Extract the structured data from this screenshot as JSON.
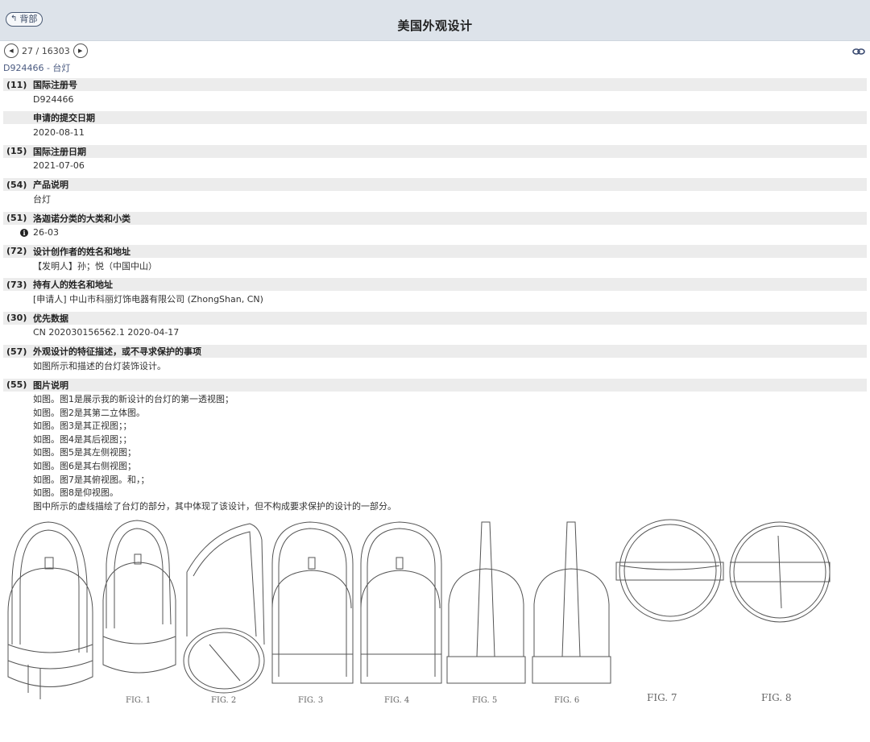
{
  "header": {
    "back_label": "背部",
    "title": "美国外观设计"
  },
  "pager": {
    "position": "27 / 16303"
  },
  "record": {
    "id_title": "D924466 - 台灯"
  },
  "fields": [
    {
      "code": "(11)",
      "label": "国际注册号",
      "value": "D924466"
    },
    {
      "code": "",
      "label": "申请的提交日期",
      "value": "2020-08-11"
    },
    {
      "code": "(15)",
      "label": "国际注册日期",
      "value": "2021-07-06"
    },
    {
      "code": "(54)",
      "label": "产品说明",
      "value": "台灯"
    },
    {
      "code": "(51)",
      "label": "洛迦诺分类的大类和小类",
      "value": "26-03"
    },
    {
      "code": "(72)",
      "label": "设计创作者的姓名和地址",
      "value": "【发明人】孙；悦（中国中山）"
    },
    {
      "code": "(73)",
      "label": "持有人的姓名和地址",
      "value": "[申请人] 中山市科丽灯饰电器有限公司 (ZhongShan, CN)"
    },
    {
      "code": "(30)",
      "label": "优先数据",
      "value": "CN 202030156562.1 2020-04-17"
    },
    {
      "code": "(57)",
      "label": "外观设计的特征描述，或不寻求保护的事项",
      "value": "如图所示和描述的台灯装饰设计。"
    },
    {
      "code": "(55)",
      "label": "图片说明",
      "value": ""
    }
  ],
  "figure_description": [
    "如图。图1是展示我的新设计的台灯的第一透视图；",
    "如图。图2是其第二立体图。",
    "如图。图3是其正视图；；",
    "如图。图4是其后视图；；",
    "如图。图5是其左侧视图；",
    "如图。图6是其右侧视图；",
    "如图。图7是其俯视图。和，；",
    "如图。图8是仰视图。",
    "图中所示的虚线描绘了台灯的部分，其中体现了该设计，但不构成要求保护的设计的一部分。"
  ],
  "figure_labels": [
    "FIG. 1",
    "FIG. 2",
    "FIG. 3",
    "FIG. 4",
    "FIG. 5",
    "FIG. 6",
    "FIG. 7",
    "FIG. 8"
  ],
  "icons": {
    "back": "back-arrow-icon",
    "prev": "prev-circle-icon",
    "next": "next-circle-icon",
    "link": "link-icon",
    "info": "info-icon"
  }
}
